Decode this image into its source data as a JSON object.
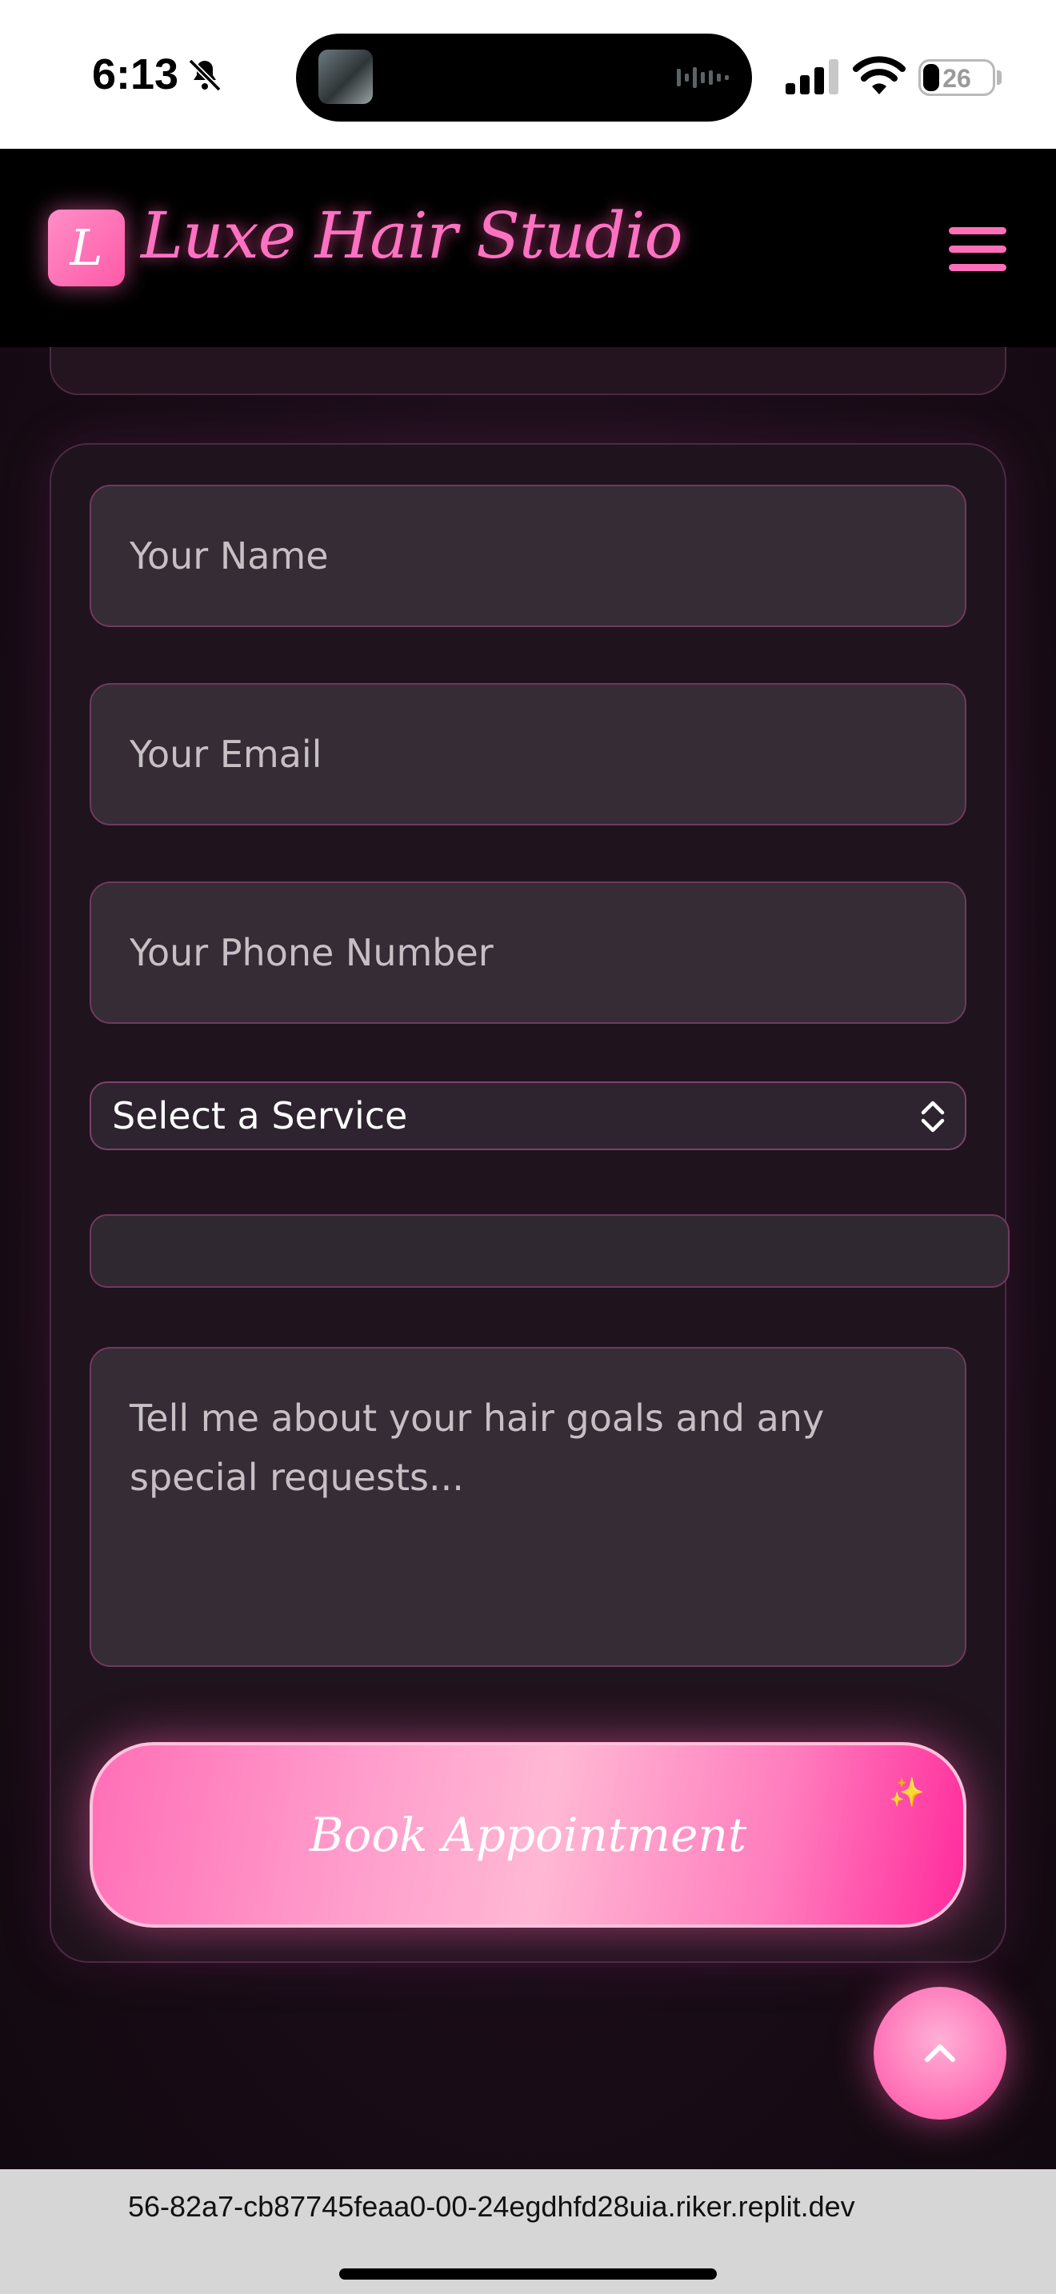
{
  "status_bar": {
    "time": "6:13",
    "battery_level": "26",
    "icons": [
      "bell-slash-icon",
      "signal-icon",
      "wifi-icon",
      "battery-icon"
    ]
  },
  "header": {
    "logo_letter": "L",
    "title": "Luxe Hair Studio",
    "menu_icon": "hamburger-menu-icon"
  },
  "form": {
    "name_placeholder": "Your Name",
    "email_placeholder": "Your Email",
    "phone_placeholder": "Your Phone Number",
    "service_selected": "Select a Service",
    "message_placeholder": "Tell me about your hair goals and any special requests...",
    "submit_label": "Book Appointment",
    "sparkle": "✨"
  },
  "colors": {
    "accent_pink": "#ff6fb8",
    "background": "#150b13",
    "field_bg": "#352c35"
  },
  "browser": {
    "url": "56-82a7-cb87745feaa0-00-24egdhfd28uia.riker.replit.dev"
  }
}
